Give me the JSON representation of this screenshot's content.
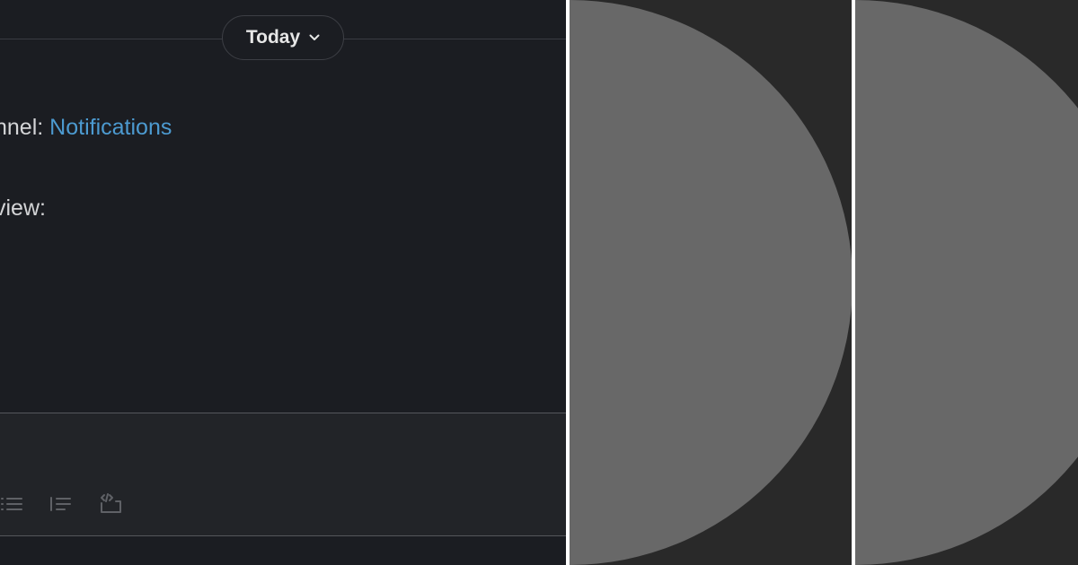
{
  "chat": {
    "day_divider": {
      "label": "Today",
      "icon": "chevron-down-icon"
    },
    "message": {
      "channel_prefix": "nnel: ",
      "channel_name": "Notifications",
      "preview_prefix": "view:"
    },
    "composer": {
      "toolbar": {
        "bullet_list_icon": "bulleted-list-icon",
        "numbered_list_icon": "numbered-list-icon",
        "code_block_icon": "code-block-icon"
      }
    }
  },
  "avatars": [
    {
      "shape": "half-circle",
      "color": "#686868"
    },
    {
      "shape": "half-circle",
      "color": "#686868"
    }
  ],
  "colors": {
    "background": "#1b1d22",
    "composer": "#222428",
    "text": "#d4d5d7",
    "link": "#4c9ad0",
    "side_panel": "#292929",
    "circle": "#686868"
  }
}
